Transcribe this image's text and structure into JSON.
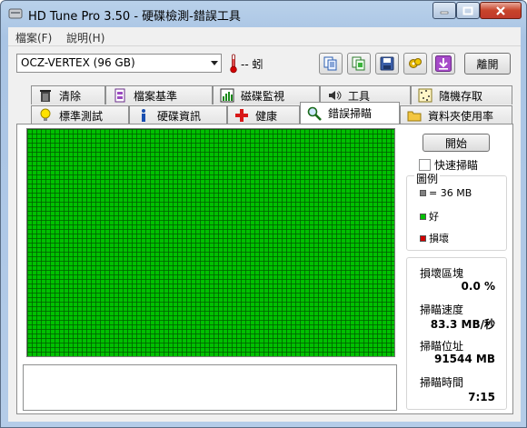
{
  "window": {
    "title": "HD Tune Pro 3.50 - 硬碟檢測-錯誤工具"
  },
  "menu": {
    "items": [
      {
        "label": "檔案(F)"
      },
      {
        "label": "說明(H)"
      }
    ]
  },
  "toolbar": {
    "drive": "OCZ-VERTEX (96 GB)",
    "temperature": "-- 蚓",
    "exit_label": "離開",
    "buttons": [
      "copy-text-icon",
      "copy-screenshot-icon",
      "save-icon",
      "options-icon",
      "download-icon"
    ]
  },
  "tabs": {
    "row1": [
      {
        "label": "清除",
        "icon": "trash-icon"
      },
      {
        "label": "檔案基準",
        "icon": "file-benchmark-icon"
      },
      {
        "label": "磁碟監視",
        "icon": "disk-monitor-icon"
      },
      {
        "label": "工具",
        "icon": "speaker-icon"
      },
      {
        "label": "隨機存取",
        "icon": "random-access-icon"
      }
    ],
    "row2": [
      {
        "label": "標準測試",
        "icon": "lightbulb-icon"
      },
      {
        "label": "硬碟資訊",
        "icon": "info-icon"
      },
      {
        "label": "健康",
        "icon": "health-cross-icon"
      },
      {
        "label": "錯誤掃瞄",
        "icon": "magnifier-icon",
        "active": true
      },
      {
        "label": "資料夾使用率",
        "icon": "folder-icon"
      }
    ]
  },
  "scan": {
    "start_label": "開始",
    "quick_scan_label": "快速掃瞄",
    "quick_scan_checked": false,
    "legend_title": "圖例",
    "legend": [
      {
        "label": "= 36 MB",
        "color": "#808080"
      },
      {
        "label": "好",
        "color": "#00c000"
      },
      {
        "label": "損壞",
        "color": "#d00000"
      }
    ],
    "stats": [
      {
        "label": "損壞區塊",
        "value": "0.0 %"
      },
      {
        "label": "掃瞄速度",
        "value": "83.3 MB/秒"
      },
      {
        "label": "掃瞄位址",
        "value": "91544 MB"
      },
      {
        "label": "掃瞄時間",
        "value": "7:15"
      }
    ],
    "block_status": "all-good",
    "log_text": ""
  },
  "colors": {
    "good": "#00c000",
    "damaged": "#d00000"
  }
}
